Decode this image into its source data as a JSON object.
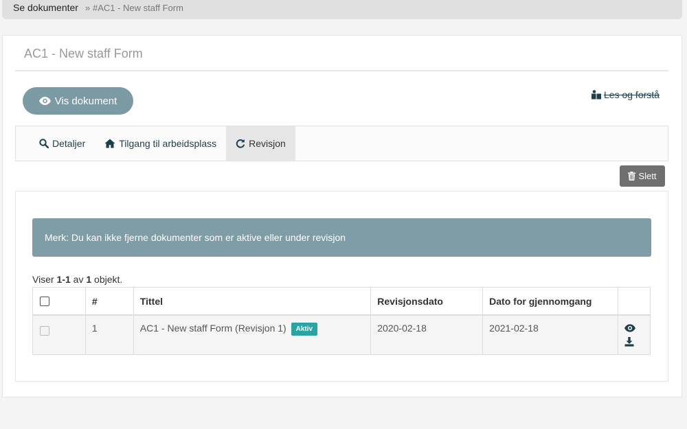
{
  "breadcrumb": {
    "root": "Se dokumenter",
    "separator": "»",
    "current": "#AC1 - New staff Form"
  },
  "page": {
    "title": "AC1 - New staff Form"
  },
  "actions": {
    "view_document": "Vis dokument",
    "read_understand": "Les og forstå",
    "delete": "Slett"
  },
  "tabs": [
    {
      "label": "Detaljer",
      "icon": "search-icon"
    },
    {
      "label": "Tilgang til arbeidsplass",
      "icon": "home-icon"
    },
    {
      "label": "Revisjon",
      "icon": "refresh-icon",
      "active": true
    }
  ],
  "alert": {
    "text": "Merk: Du kan ikke fjerne dokumenter som er aktive eller under revisjon"
  },
  "summary": {
    "prefix": "Viser",
    "range": "1-1",
    "of": "av",
    "total": "1",
    "suffix": "objekt."
  },
  "table": {
    "headers": {
      "number": "#",
      "title": "Tittel",
      "revision_date": "Revisjonsdato",
      "review_date": "Dato for gjennomgang"
    },
    "rows": [
      {
        "number": "1",
        "title": "AC1 - New staff Form (Revisjon 1)",
        "status": "Aktiv",
        "revision_date": "2020-02-18",
        "review_date": "2021-02-18"
      }
    ]
  },
  "colors": {
    "accent": "#7b9ba4",
    "link": "#1f3e4c",
    "badge": "#2aa3a3",
    "delete": "#6f6f6f"
  }
}
